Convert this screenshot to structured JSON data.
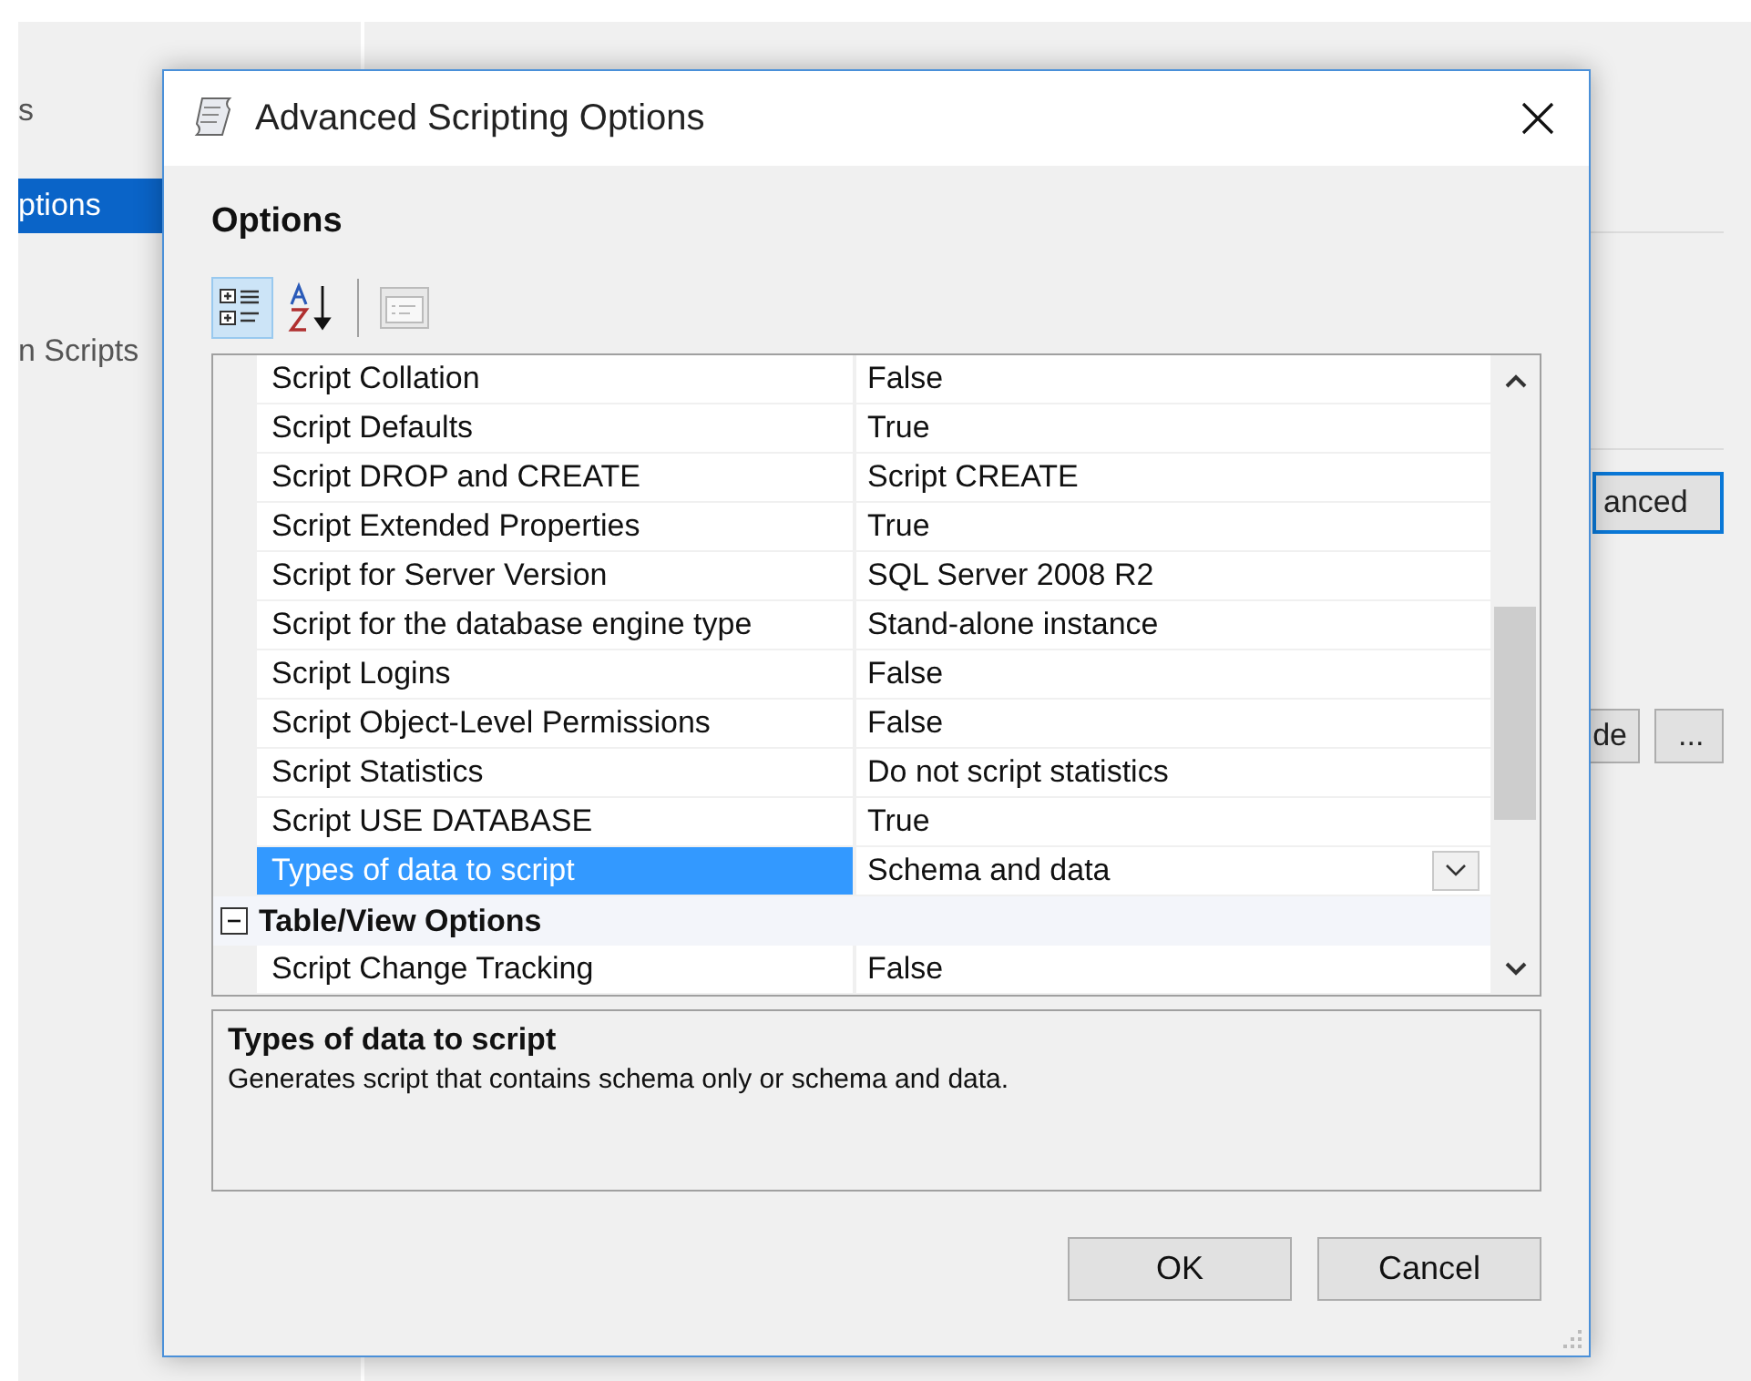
{
  "background_window": {
    "sidebar": [
      {
        "label": "s",
        "selected": false
      },
      {
        "label": "ptions",
        "selected": true
      },
      {
        "label": "n Scripts",
        "selected": false
      }
    ],
    "buttons": [
      {
        "label": "anced",
        "kind": "default"
      },
      {
        "label": "de",
        "kind": "normal"
      },
      {
        "label": "...",
        "kind": "normal"
      }
    ]
  },
  "dialog": {
    "title": "Advanced Scripting Options",
    "section_title": "Options",
    "toolbar": [
      {
        "kind": "categorized",
        "selected": true,
        "disabled": false
      },
      {
        "kind": "alphabetical",
        "selected": false,
        "disabled": false
      },
      {
        "kind": "property-pages",
        "selected": false,
        "disabled": true
      }
    ],
    "properties": [
      {
        "kind": "property",
        "name": "Script Collation",
        "value": "False",
        "selected": false
      },
      {
        "kind": "property",
        "name": "Script Defaults",
        "value": "True",
        "selected": false
      },
      {
        "kind": "property",
        "name": "Script DROP and CREATE",
        "value": "Script CREATE",
        "selected": false
      },
      {
        "kind": "property",
        "name": "Script Extended Properties",
        "value": "True",
        "selected": false
      },
      {
        "kind": "property",
        "name": "Script for Server Version",
        "value": "SQL Server 2008 R2",
        "selected": false
      },
      {
        "kind": "property",
        "name": "Script for the database engine type",
        "value": "Stand-alone instance",
        "selected": false
      },
      {
        "kind": "property",
        "name": "Script Logins",
        "value": "False",
        "selected": false
      },
      {
        "kind": "property",
        "name": "Script Object-Level Permissions",
        "value": "False",
        "selected": false
      },
      {
        "kind": "property",
        "name": "Script Statistics",
        "value": "Do not script statistics",
        "selected": false
      },
      {
        "kind": "property",
        "name": "Script USE DATABASE",
        "value": "True",
        "selected": false
      },
      {
        "kind": "property",
        "name": "Types of data to script",
        "value": "Schema and data",
        "selected": true
      },
      {
        "kind": "category",
        "name": "Table/View Options",
        "expanded": true
      },
      {
        "kind": "property",
        "name": "Script Change Tracking",
        "value": "False",
        "selected": false
      }
    ],
    "description": {
      "title": "Types of data to script",
      "text": "Generates script that contains schema only or schema and data."
    },
    "buttons": [
      "OK",
      "Cancel"
    ]
  }
}
